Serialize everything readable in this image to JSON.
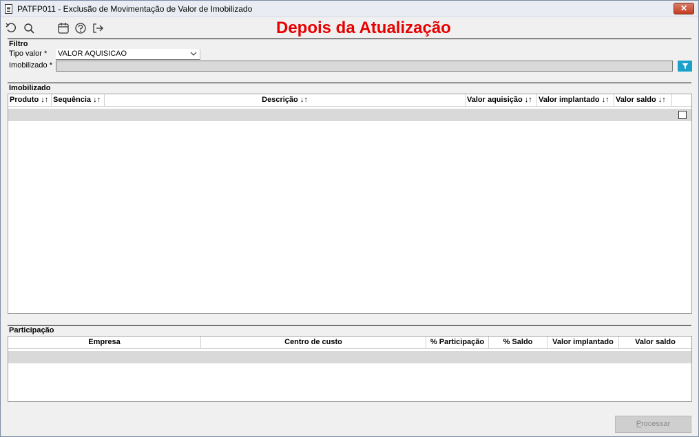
{
  "window": {
    "title": "PATFP011 - Exclusão de Movimentação de Valor de Imobilizado",
    "close_label": "✕"
  },
  "toolbar": {
    "icons": [
      "undo-icon",
      "search-icon",
      "calendar-icon",
      "help-icon",
      "exit-icon"
    ]
  },
  "banner": {
    "text": "Depois da Atualização",
    "color": "#e60000"
  },
  "filtro": {
    "section_label": "Filtro",
    "tipo_valor_label": "Tipo valor *",
    "tipo_valor_value": "VALOR AQUISICAO",
    "imobilizado_label": "Imobilizado *",
    "imobilizado_value": ""
  },
  "imobilizado_grid": {
    "section_label": "Imobilizado",
    "columns": [
      "Produto ↓↑",
      "Sequência ↓↑",
      "Descrição ↓↑",
      "Valor aquisição ↓↑",
      "Valor implantado ↓↑",
      "Valor saldo ↓↑"
    ]
  },
  "participacao_grid": {
    "section_label": "Participação",
    "columns": [
      "Empresa",
      "Centro de custo",
      "% Participação",
      "% Saldo",
      "Valor implantado",
      "Valor saldo"
    ]
  },
  "actions": {
    "processar_accel": "P",
    "processar_rest": "rocessar"
  },
  "colors": {
    "filter_button": "#1aa0c9",
    "row_fill": "#d9d9d9"
  }
}
